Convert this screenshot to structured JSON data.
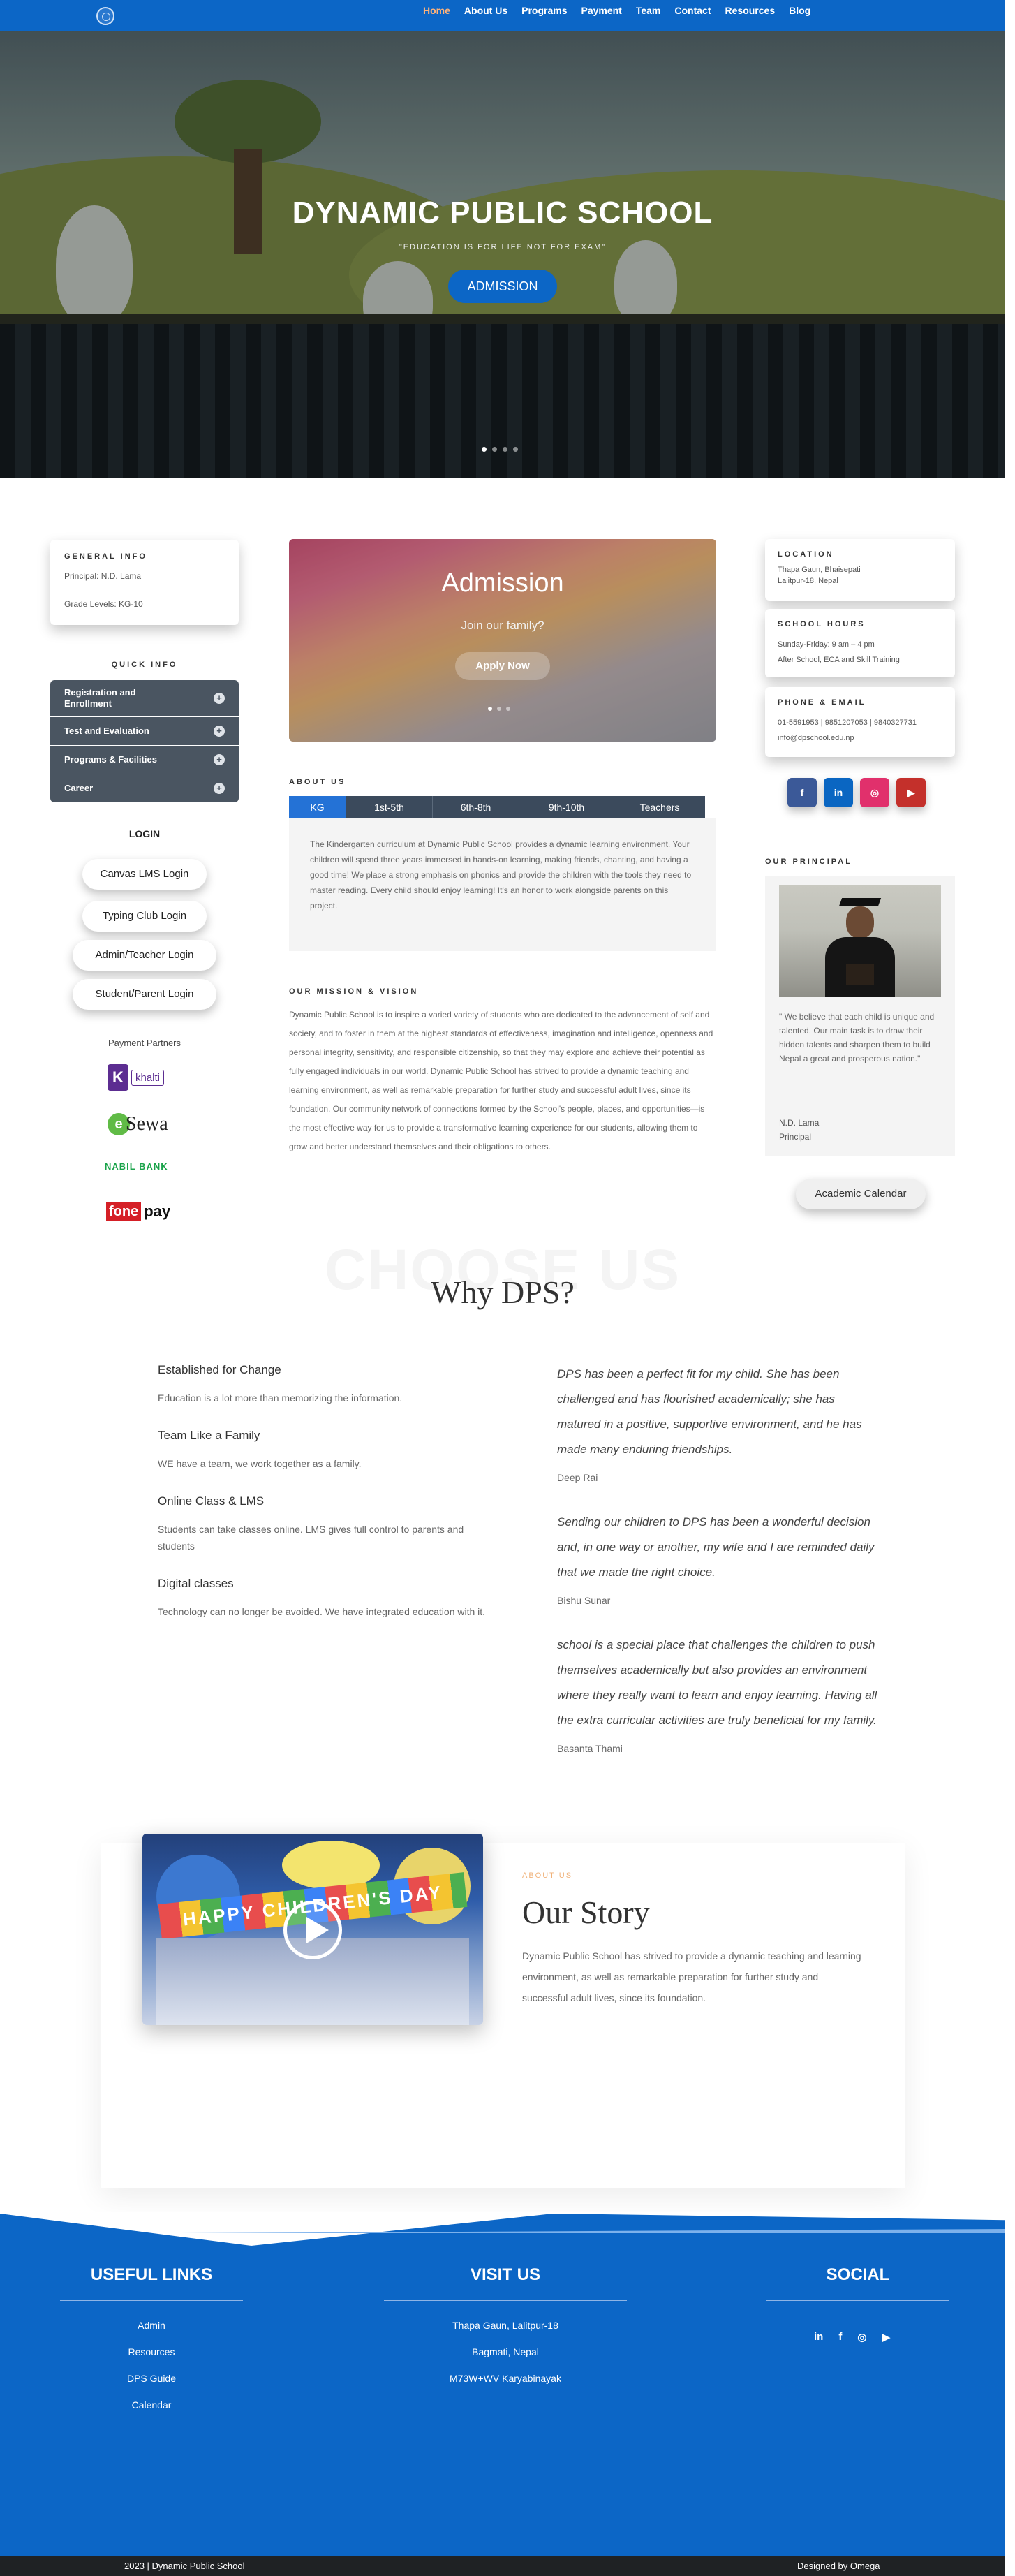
{
  "nav": {
    "items": [
      "Home",
      "About Us",
      "Programs",
      "Payment",
      "Team",
      "Contact",
      "Resources",
      "Blog"
    ],
    "active": "Home",
    "bg_color": "#0c66c6",
    "active_color": "#ffb37a",
    "logo_icon": "school-emblem-icon"
  },
  "hero": {
    "title": "DYNAMIC PUBLIC SCHOOL",
    "tagline": "\"EDUCATION IS FOR LIFE NOT FOR EXAM\"",
    "button": "ADMISSION",
    "slides": 4,
    "active_slide": 1
  },
  "general_info": {
    "heading": "GENERAL INFO",
    "principal": "Principal: N.D. Lama",
    "grade": "Grade Levels: KG-10"
  },
  "quick_info": {
    "heading": "QUICK INFO",
    "items": [
      "Registration and Enrollment",
      "Test and Evaluation",
      "Programs & Facilities",
      "Career"
    ]
  },
  "login": {
    "heading": "LOGIN",
    "buttons": [
      "Canvas LMS Login",
      "Typing Club Login",
      "Admin/Teacher Login",
      "Student/Parent Login"
    ]
  },
  "payment": {
    "heading": "Payment Partners",
    "partners": [
      "khalti",
      "eSewa",
      "NABIL BANK",
      "fone pay"
    ]
  },
  "slider": {
    "title": "Admission",
    "subtitle": "Join our family?",
    "button": "Apply Now",
    "slides": 3,
    "active_slide": 1
  },
  "about": {
    "heading": "ABOUT US",
    "tabs": [
      "KG",
      "1st-5th",
      "6th-8th",
      "9th-10th",
      "Teachers"
    ],
    "active_tab": "KG",
    "text": "The Kindergarten curriculum at Dynamic Public School provides a dynamic learning environment. Your children will spend three years immersed in hands-on learning, making friends, chanting, and having a good time! We place a strong emphasis on phonics and provide the children with the tools they need to master reading. Every child should enjoy learning! It's an honor to work alongside parents on this project."
  },
  "mission": {
    "heading": "OUR MISSION & VISION",
    "text": "Dynamic Public School is to inspire a varied variety of students who are dedicated to the advancement of self and society, and to foster in them at the highest standards of effectiveness, imagination and intelligence, openness and personal integrity, sensitivity, and responsible citizenship, so that they may explore and achieve their potential as fully engaged individuals in our world. Dynamic Public School has strived to provide a dynamic teaching and learning environment, as well as remarkable preparation for further study and successful adult lives, since its foundation. Our community network of connections formed by the School's people, places, and opportunities—is the most effective way for us to provide a transformative learning experience for our students, allowing them to grow and better understand themselves and their obligations to others."
  },
  "location": {
    "heading": "LOCATION",
    "line1": "Thapa Gaun, Bhaisepati",
    "line2": "Lalitpur-18, Nepal"
  },
  "hours": {
    "heading": "SCHOOL HOURS",
    "line1": "Sunday-Friday: 9 am – 4 pm",
    "line2": "After School, ECA and Skill Training"
  },
  "contact": {
    "heading": "PHONE & EMAIL",
    "phone": "01-5591953 | 9851207053 | 9840327731",
    "email": "info@dpschool.edu.np"
  },
  "social": {
    "icons": [
      "facebook-icon",
      "linkedin-icon",
      "instagram-icon",
      "youtube-icon"
    ],
    "glyphs": [
      "f",
      "in",
      "◎",
      "▶"
    ],
    "colors": [
      "#3b5998",
      "#0a66c2",
      "#e1306c",
      "#c4302b"
    ]
  },
  "principal": {
    "heading": "OUR PRINCIPAL",
    "quote": "\" We believe that each child is unique and talented. Our main task is to draw their hidden talents and sharpen them to build Nepal a great and prosperous nation.\"",
    "name": "N.D. Lama",
    "role": "Principal"
  },
  "calendar_button": "Academic Calendar",
  "why": {
    "watermark": "CHOOSE US",
    "title": "Why DPS?",
    "features": [
      {
        "title": "Established for Change",
        "text": "Education is a lot more than memorizing the information."
      },
      {
        "title": "Team Like a Family",
        "text": "WE have a team, we work together as a family."
      },
      {
        "title": "Online Class & LMS",
        "text": "Students can take classes online. LMS gives full control to parents and students"
      },
      {
        "title": "Digital classes",
        "text": "Technology can no longer be avoided. We have integrated education with it."
      }
    ],
    "testimonials": [
      {
        "quote": "DPS has been a perfect fit for my child. She has been challenged and has flourished academically; she has matured in a positive, supportive environment, and he has made many enduring friendships.",
        "name": "Deep Rai"
      },
      {
        "quote": "Sending our children to DPS has been a wonderful decision and, in one way or another, my wife and I are reminded daily that we made the right choice.",
        "name": "Bishu Sunar"
      },
      {
        "quote": "school is a special place that challenges the children to push themselves academically but also provides an environment where they really want to learn and enjoy learning. Having all the extra curricular activities are truly beneficial for my family.",
        "name": "Basanta Thami"
      }
    ]
  },
  "story": {
    "kicker": "ABOUT US",
    "title": "Our Story",
    "text": "Dynamic Public School has strived to provide a dynamic teaching and learning environment, as well as remarkable preparation for further study and successful adult lives, since its foundation.",
    "banner": "HAPPY CHILDREN'S DAY",
    "play_icon": "play-icon"
  },
  "footer": {
    "useful_heading": "USEFUL LINKS",
    "useful_links": [
      "Admin",
      "Resources",
      "DPS Guide",
      "Calendar"
    ],
    "visit_heading": "VISIT US",
    "visit_lines": [
      "Thapa Gaun, Lalitpur-18",
      "Bagmati, Nepal",
      "M73W+WV Karyabinayak"
    ],
    "social_heading": "SOCIAL",
    "social_icons": [
      "linkedin-icon",
      "facebook-icon",
      "instagram-icon",
      "youtube-icon"
    ],
    "social_glyphs": [
      "in",
      "f",
      "◎",
      "▶"
    ],
    "copyright": "2023 | Dynamic Public School",
    "credit": "Designed by Omega"
  }
}
